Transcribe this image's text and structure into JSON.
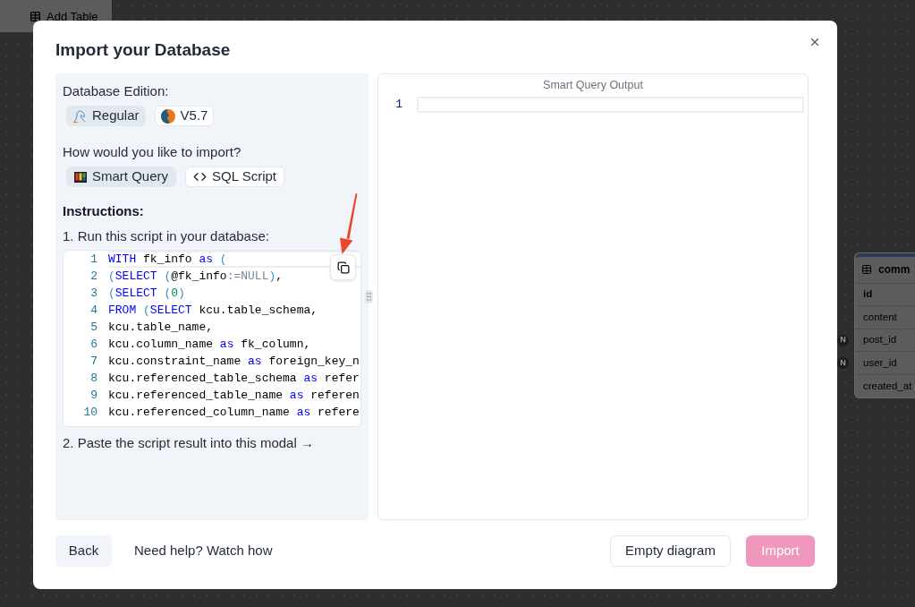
{
  "background": {
    "toolbar": {
      "add_table": "Add Table"
    },
    "table_node": {
      "title": "comm",
      "columns": [
        {
          "name": "id",
          "primary": true
        },
        {
          "name": "content",
          "primary": false
        },
        {
          "name": "post_id",
          "primary": false,
          "badge": "N"
        },
        {
          "name": "user_id",
          "primary": false,
          "badge": "N"
        },
        {
          "name": "created_at",
          "primary": false
        }
      ]
    }
  },
  "dialog": {
    "title": "Import your Database",
    "edition": {
      "label": "Database Edition:",
      "options": [
        {
          "label": "Regular",
          "selected": true
        },
        {
          "label": "V5.7",
          "selected": false
        }
      ]
    },
    "import_method": {
      "label": "How would you like to import?",
      "options": [
        {
          "label": "Smart Query",
          "selected": true
        },
        {
          "label": "SQL Script",
          "selected": false
        }
      ]
    },
    "instructions": {
      "heading": "Instructions:",
      "step_1": "1. Run this script in your database:",
      "step_2": "2. Paste the script result into this modal →",
      "code": {
        "lines": [
          {
            "number": "1",
            "active": true,
            "tokens": [
              {
                "kind": "keyword",
                "text": "WITH"
              },
              {
                "kind": "plain",
                "text": " fk_info "
              },
              {
                "kind": "keyword",
                "text": "as"
              },
              {
                "kind": "paren",
                "text": " ("
              }
            ]
          },
          {
            "number": "2",
            "active": false,
            "tokens": [
              {
                "kind": "paren",
                "text": "("
              },
              {
                "kind": "keyword",
                "text": "SELECT"
              },
              {
                "kind": "paren",
                "text": " ("
              },
              {
                "kind": "plain",
                "text": "@fk_info"
              },
              {
                "kind": "operator",
                "text": ":="
              },
              {
                "kind": "constant",
                "text": "NULL"
              },
              {
                "kind": "paren",
                "text": ")"
              },
              {
                "kind": "plain",
                "text": ","
              }
            ]
          },
          {
            "number": "3",
            "active": false,
            "tokens": [
              {
                "kind": "paren",
                "text": "("
              },
              {
                "kind": "keyword",
                "text": "SELECT"
              },
              {
                "kind": "paren",
                "text": " ("
              },
              {
                "kind": "number",
                "text": "0"
              },
              {
                "kind": "paren",
                "text": ")"
              }
            ]
          },
          {
            "number": "4",
            "active": false,
            "tokens": [
              {
                "kind": "keyword",
                "text": "FROM"
              },
              {
                "kind": "paren",
                "text": " ("
              },
              {
                "kind": "keyword",
                "text": "SELECT"
              },
              {
                "kind": "plain",
                "text": " kcu.table_schema,"
              }
            ]
          },
          {
            "number": "5",
            "active": false,
            "tokens": [
              {
                "kind": "plain",
                "text": "kcu.table_name,"
              }
            ]
          },
          {
            "number": "6",
            "active": false,
            "tokens": [
              {
                "kind": "plain",
                "text": "kcu.column_name "
              },
              {
                "kind": "keyword",
                "text": "as"
              },
              {
                "kind": "plain",
                "text": " fk_column,"
              }
            ]
          },
          {
            "number": "7",
            "active": false,
            "tokens": [
              {
                "kind": "plain",
                "text": "kcu.constraint_name "
              },
              {
                "kind": "keyword",
                "text": "as"
              },
              {
                "kind": "plain",
                "text": " foreign_key_n"
              }
            ]
          },
          {
            "number": "8",
            "active": false,
            "tokens": [
              {
                "kind": "plain",
                "text": "kcu.referenced_table_schema "
              },
              {
                "kind": "keyword",
                "text": "as"
              },
              {
                "kind": "plain",
                "text": " refer"
              }
            ]
          },
          {
            "number": "9",
            "active": false,
            "tokens": [
              {
                "kind": "plain",
                "text": "kcu.referenced_table_name "
              },
              {
                "kind": "keyword",
                "text": "as"
              },
              {
                "kind": "plain",
                "text": " referen"
              }
            ]
          },
          {
            "number": "10",
            "active": false,
            "tokens": [
              {
                "kind": "plain",
                "text": "kcu.referenced_column_name "
              },
              {
                "kind": "keyword",
                "text": "as"
              },
              {
                "kind": "plain",
                "text": " refere"
              }
            ]
          }
        ]
      }
    },
    "output": {
      "title": "Smart Query Output",
      "lines": [
        {
          "number": "1",
          "active": true
        }
      ]
    },
    "footer": {
      "back": "Back",
      "help": "Need help? Watch how",
      "empty_diagram": "Empty diagram",
      "import": {
        "label": "Import",
        "disabled": true
      }
    }
  }
}
